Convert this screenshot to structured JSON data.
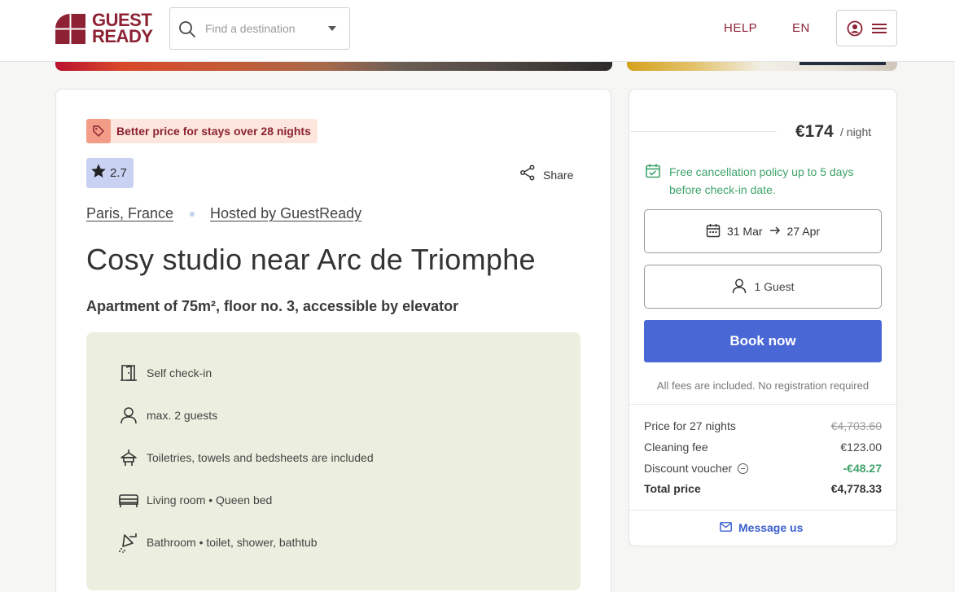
{
  "header": {
    "logo_line1": "GUEST",
    "logo_line2": "READY",
    "search_placeholder": "Find a destination",
    "help_label": "HELP",
    "lang_label": "EN"
  },
  "listing": {
    "promo": "Better price for stays over 28 nights",
    "rating": "2.7",
    "share_label": "Share",
    "location": "Paris, France",
    "host": "Hosted by GuestReady",
    "title": "Cosy studio near Arc de Triomphe",
    "subtitle": "Apartment of 75m², floor no. 3, accessible by elevator",
    "features": [
      {
        "icon": "door-icon",
        "text": "Self check-in"
      },
      {
        "icon": "person-icon",
        "text": "max. 2 guests"
      },
      {
        "icon": "hanger-icon",
        "text": "Toiletries, towels and bedsheets are included"
      },
      {
        "icon": "bed-icon",
        "text": "Living room • Queen bed"
      },
      {
        "icon": "shower-icon",
        "text": "Bathroom • toilet, shower, bathtub"
      }
    ]
  },
  "booking": {
    "price": "€174",
    "per_night": "/ night",
    "cancellation": "Free cancellation policy up to 5 days before check-in date.",
    "date_from": "31 Mar",
    "date_to": "27 Apr",
    "guests": "1 Guest",
    "book_label": "Book now",
    "fees_note": "All fees are included. No registration required",
    "rows": [
      {
        "label": "Price for 27 nights",
        "value": "€4,703.60"
      },
      {
        "label": "Cleaning fee",
        "value": "€123.00"
      },
      {
        "label": "Discount voucher",
        "value": "-€48.27"
      },
      {
        "label": "Total price",
        "value": "€4,778.33"
      }
    ],
    "message_label": "Message us"
  },
  "colors": {
    "brand": "#8c2234",
    "accent": "#4a67d6",
    "success": "#3fa36a"
  }
}
